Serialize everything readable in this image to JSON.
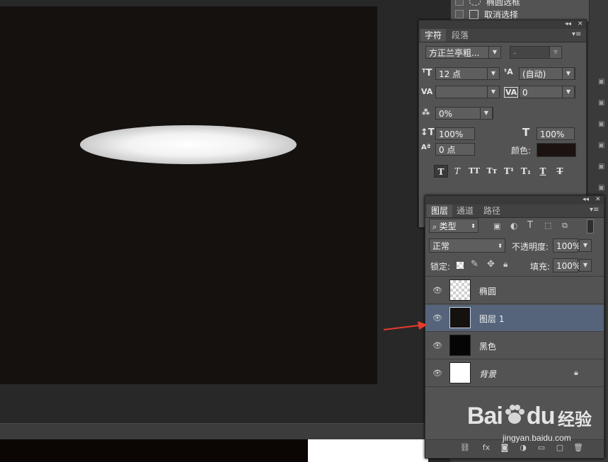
{
  "top_menu": {
    "items": [
      {
        "label": "椭圆选框"
      },
      {
        "label": "取消选择"
      }
    ]
  },
  "character_panel": {
    "tabs": [
      "字符",
      "段落"
    ],
    "font_family": "方正兰亭粗...",
    "font_style": "-",
    "font_size": "12 点",
    "leading": "(自动)",
    "kerning": "",
    "tracking": "0",
    "scale_percent": "0%",
    "vertical_scale": "100%",
    "horizontal_scale": "100%",
    "baseline_shift": "0 点",
    "color_label": "颜色:",
    "color_value": "#1a1310",
    "style_buttons": [
      "T",
      "T",
      "TT",
      "Tт",
      "T¹",
      "T₁",
      "T",
      "T"
    ]
  },
  "layers_panel": {
    "tabs": [
      "图层",
      "通道",
      "路径"
    ],
    "filter_kind": "类型",
    "blend_mode": "正常",
    "opacity_label": "不透明度:",
    "opacity_value": "100%",
    "lock_label": "锁定:",
    "fill_label": "填充:",
    "fill_value": "100%",
    "layers": [
      {
        "name": "椭圆",
        "thumb": "transparent",
        "selected": false,
        "locked": false
      },
      {
        "name": "图层 1",
        "thumb": "#15110f",
        "selected": true,
        "locked": false
      },
      {
        "name": "黑色",
        "thumb": "#050505",
        "selected": false,
        "locked": false
      },
      {
        "name": "背景",
        "thumb": "#ffffff",
        "selected": false,
        "locked": true
      }
    ]
  },
  "watermark": {
    "brand": "Bai",
    "brand2": "du",
    "suffix": "经验",
    "url": "jingyan.baidu.com"
  },
  "colors": {
    "canvas": "#15110f",
    "selection": "#55647a",
    "arrow": "#e83a2c"
  }
}
